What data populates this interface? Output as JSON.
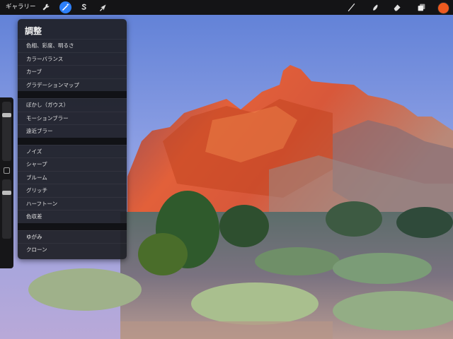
{
  "toolbar": {
    "gallery_label": "ギャラリー",
    "left_tools": [
      {
        "icon": "wrench-icon",
        "active": false
      },
      {
        "icon": "magic-wand-icon",
        "active": true
      },
      {
        "icon": "selection-s-icon",
        "active": false
      },
      {
        "icon": "arrow-cursor-icon",
        "active": false
      }
    ],
    "right_tools": [
      {
        "icon": "brush-icon"
      },
      {
        "icon": "smudge-icon"
      },
      {
        "icon": "eraser-icon"
      },
      {
        "icon": "layers-icon"
      }
    ],
    "current_color": "#ee5a1f",
    "active_color": "#2d7ff9"
  },
  "sidebar": {
    "brush_size_level": 0.25,
    "opacity_level": 0.35
  },
  "menu": {
    "title": "調整",
    "groups": [
      [
        "色相、彩度、明るさ",
        "カラーバランス",
        "カーブ",
        "グラデーションマップ"
      ],
      [
        "ぼかし（ガウス）",
        "モーションブラー",
        "遠近ブラー"
      ],
      [
        "ノイズ",
        "シャープ",
        "ブルーム",
        "グリッチ",
        "ハーフトーン",
        "色収差"
      ],
      [
        "ゆがみ",
        "クローン"
      ]
    ]
  }
}
